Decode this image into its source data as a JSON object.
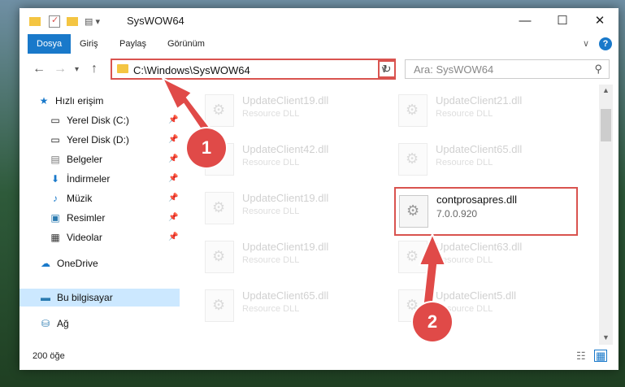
{
  "window": {
    "title": "SysWOW64",
    "controls": {
      "minimize": "—",
      "maximize": "☐",
      "close": "✕"
    }
  },
  "ribbon": {
    "tabs": [
      "Dosya",
      "Giriş",
      "Paylaş",
      "Görünüm"
    ],
    "collapse": "∨",
    "help": "?"
  },
  "address": {
    "path": "C:\\Windows\\SysWOW64",
    "search_placeholder": "Ara: SysWOW64"
  },
  "sidebar": {
    "quick_access": "Hızlı erişim",
    "items": [
      {
        "label": "Yerel Disk (C:)",
        "icon": "drive-icon"
      },
      {
        "label": "Yerel Disk (D:)",
        "icon": "drive-icon"
      },
      {
        "label": "Belgeler",
        "icon": "documents-icon"
      },
      {
        "label": "İndirmeler",
        "icon": "downloads-icon"
      },
      {
        "label": "Müzik",
        "icon": "music-icon"
      },
      {
        "label": "Resimler",
        "icon": "pictures-icon"
      },
      {
        "label": "Videolar",
        "icon": "videos-icon"
      }
    ],
    "onedrive": "OneDrive",
    "this_pc": "Bu bilgisayar",
    "network": "Ağ"
  },
  "files": [
    {
      "name": "UpdateClient19.dll",
      "sub": "Resource DLL"
    },
    {
      "name": "UpdateClient21.dll",
      "sub": "Resource DLL"
    },
    {
      "name": "UpdateClient42.dll",
      "sub": "Resource DLL"
    },
    {
      "name": "UpdateClient65.dll",
      "sub": "Resource DLL"
    },
    {
      "name": "UpdateClient19.dll",
      "sub": "Resource DLL"
    },
    {
      "name": "contprosapres.dll",
      "sub": "7.0.0.920"
    },
    {
      "name": "UpdateClient19.dll",
      "sub": "Resource DLL"
    },
    {
      "name": "UpdateClient63.dll",
      "sub": "Resource DLL"
    },
    {
      "name": "UpdateClient65.dll",
      "sub": "Resource DLL"
    },
    {
      "name": "UpdateClient5.dll",
      "sub": "Resource DLL"
    }
  ],
  "status": {
    "count": "200 öğe"
  },
  "annotations": {
    "step1": "1",
    "step2": "2"
  }
}
